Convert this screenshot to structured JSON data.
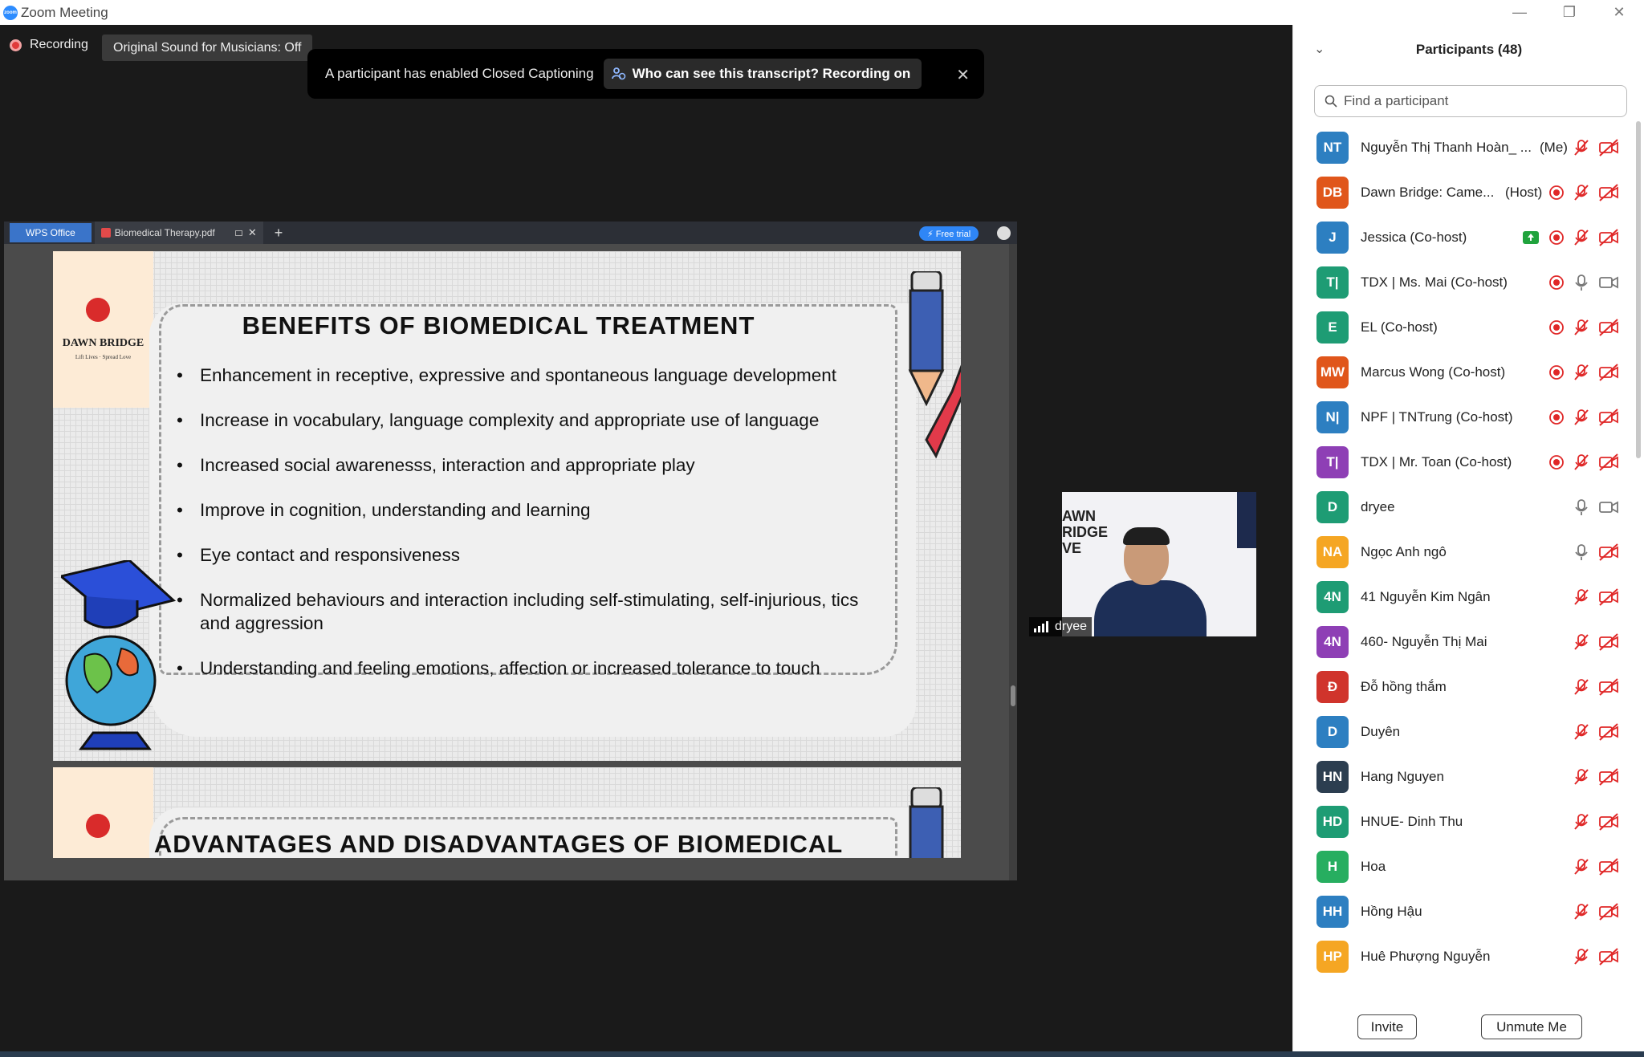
{
  "window": {
    "title": "Zoom Meeting"
  },
  "meeting": {
    "recording_label": "Recording",
    "sound_button": "Original Sound for Musicians: Off",
    "caption_toast": {
      "message": "A participant has enabled Closed Captioning",
      "pill": "Who can see this transcript? Recording on"
    }
  },
  "share": {
    "app_tab": "WPS Office",
    "doc_tab": "Biomedical Therapy.pdf",
    "free_trial": "⚡ Free trial",
    "slide1": {
      "logo": "DAWN BRIDGE",
      "logo_sub": "Lift Lives · Spread Love",
      "title": "BENEFITS OF BIOMEDICAL TREATMENT",
      "bullets": [
        "Enhancement in receptive, expressive and spontaneous language development",
        "Increase in vocabulary, language complexity and appropriate use of language",
        "Increased social awarenesss, interaction and appropriate play",
        "Improve in cognition, understanding and learning",
        "Eye contact and responsiveness",
        "Normalized behaviours and interaction including self-stimulating, self-injurious, tics and aggression",
        "Understanding and feeling emotions, affection or increased tolerance to touch"
      ]
    },
    "slide2": {
      "title": "ADVANTAGES AND DISADVANTAGES OF BIOMEDICAL"
    }
  },
  "video": {
    "banner": "AWN\nRIDGE\nVE",
    "name": "dryee"
  },
  "participants": {
    "title": "Participants (48)",
    "search_placeholder": "Find a participant",
    "list": [
      {
        "initials": "NT",
        "name": "Nguyễn Thị Thanh Hoàn_ ...",
        "tag": "(Me)",
        "color": "#2d7fc1",
        "mic": "muted",
        "cam": "off",
        "rec": false,
        "share": false
      },
      {
        "initials": "DB",
        "name": "Dawn Bridge: Came...",
        "tag": "(Host)",
        "color": "#e0561b",
        "mic": "muted",
        "cam": "off",
        "rec": true,
        "share": false
      },
      {
        "initials": "J",
        "name": "Jessica (Co-host)",
        "tag": "",
        "color": "#2d7fc1",
        "mic": "muted",
        "cam": "off",
        "rec": true,
        "share": true
      },
      {
        "initials": "T|",
        "name": "TDX | Ms. Mai (Co-host)",
        "tag": "",
        "color": "#1e9c74",
        "mic": "on",
        "cam": "on",
        "rec": true,
        "share": false
      },
      {
        "initials": "E",
        "name": "EL (Co-host)",
        "tag": "",
        "color": "#1e9c74",
        "mic": "muted",
        "cam": "off",
        "rec": true,
        "share": false
      },
      {
        "initials": "MW",
        "name": "Marcus Wong (Co-host)",
        "tag": "",
        "color": "#e0561b",
        "mic": "muted",
        "cam": "off",
        "rec": true,
        "share": false
      },
      {
        "initials": "N|",
        "name": "NPF | TNTrung (Co-host)",
        "tag": "",
        "color": "#2d7fc1",
        "mic": "muted",
        "cam": "off",
        "rec": true,
        "share": false
      },
      {
        "initials": "T|",
        "name": "TDX | Mr. Toan (Co-host)",
        "tag": "",
        "color": "#8e3fb5",
        "mic": "muted",
        "cam": "off",
        "rec": true,
        "share": false
      },
      {
        "initials": "D",
        "name": "dryee",
        "tag": "",
        "color": "#1e9c74",
        "mic": "on",
        "cam": "on",
        "rec": false,
        "share": false
      },
      {
        "initials": "NA",
        "name": "Ngọc Anh ngô",
        "tag": "",
        "color": "#f5a623",
        "mic": "on",
        "cam": "off",
        "rec": false,
        "share": false
      },
      {
        "initials": "4N",
        "name": "41 Nguyễn Kim Ngân",
        "tag": "",
        "color": "#1e9c74",
        "mic": "muted",
        "cam": "off",
        "rec": false,
        "share": false
      },
      {
        "initials": "4N",
        "name": "460- Nguyễn Thị Mai",
        "tag": "",
        "color": "#8e3fb5",
        "mic": "muted",
        "cam": "off",
        "rec": false,
        "share": false
      },
      {
        "initials": "Đ",
        "name": "Đỗ hồng thắm",
        "tag": "",
        "color": "#d0342c",
        "mic": "muted",
        "cam": "off",
        "rec": false,
        "share": false
      },
      {
        "initials": "D",
        "name": "Duyên",
        "tag": "",
        "color": "#2d7fc1",
        "mic": "muted",
        "cam": "off",
        "rec": false,
        "share": false
      },
      {
        "initials": "HN",
        "name": "Hang Nguyen",
        "tag": "",
        "color": "#2c3e50",
        "mic": "muted",
        "cam": "off",
        "rec": false,
        "share": false
      },
      {
        "initials": "HD",
        "name": "HNUE- Dinh Thu",
        "tag": "",
        "color": "#1e9c74",
        "mic": "muted",
        "cam": "off",
        "rec": false,
        "share": false
      },
      {
        "initials": "H",
        "name": "Hoa",
        "tag": "",
        "color": "#27ae60",
        "mic": "muted",
        "cam": "off",
        "rec": false,
        "share": false
      },
      {
        "initials": "HH",
        "name": "Hồng Hậu",
        "tag": "",
        "color": "#2d7fc1",
        "mic": "muted",
        "cam": "off",
        "rec": false,
        "share": false
      },
      {
        "initials": "HP",
        "name": "Huê Phượng Nguyễn",
        "tag": "",
        "color": "#f5a623",
        "mic": "muted",
        "cam": "off",
        "rec": false,
        "share": false
      }
    ],
    "invite_button": "Invite",
    "unmute_button": "Unmute Me"
  }
}
